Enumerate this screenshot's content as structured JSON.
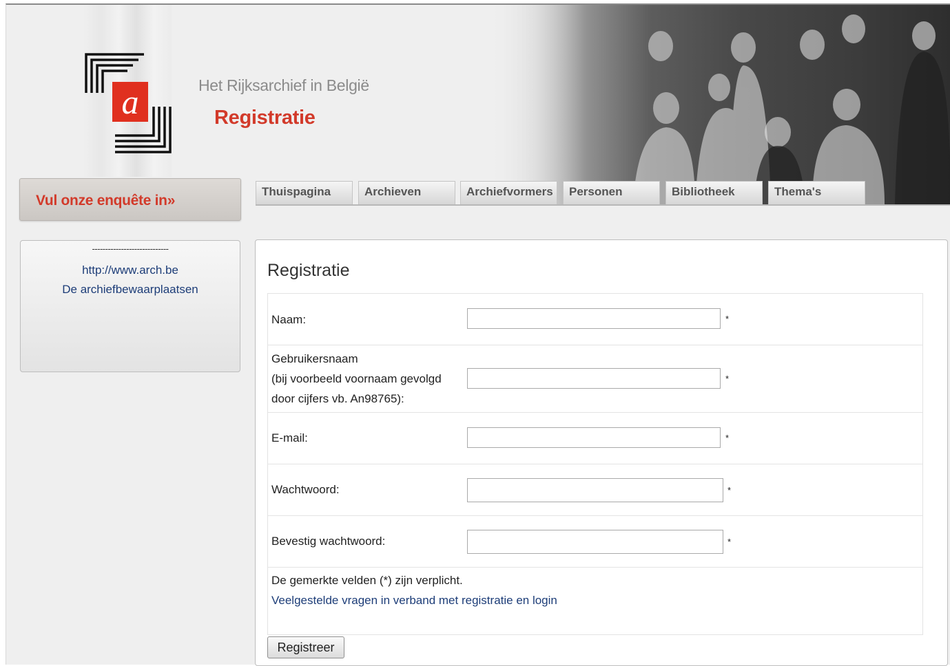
{
  "header": {
    "site_name": "Het Rijksarchief in België",
    "page_heading": "Registratie",
    "logo_letter": "a"
  },
  "survey": {
    "label": "Vul onze enquête in»"
  },
  "tabs": [
    {
      "label": "Thuispagina"
    },
    {
      "label": "Archieven"
    },
    {
      "label": "Archiefvormers"
    },
    {
      "label": "Personen"
    },
    {
      "label": "Bibliotheek"
    },
    {
      "label": "Thema's"
    }
  ],
  "sidebar": {
    "separator": "-----------------------------",
    "links": [
      {
        "label": "http://www.arch.be"
      },
      {
        "label": "De archiefbewaarplaatsen"
      }
    ]
  },
  "form": {
    "title": "Registratie",
    "fields": [
      {
        "label": "Naam:",
        "value": "",
        "required_mark": "*"
      },
      {
        "label_lines": [
          "Gebruikersnaam",
          "(bij voorbeeld voornaam gevolgd",
          "door cijfers vb. An98765):"
        ],
        "value": "",
        "required_mark": "*"
      },
      {
        "label": "E-mail:",
        "value": "",
        "required_mark": "*"
      },
      {
        "label": "Wachtwoord:",
        "value": "",
        "required_mark": "*"
      },
      {
        "label": "Bevestig wachtwoord:",
        "value": "",
        "required_mark": "*"
      }
    ],
    "required_note": "De gemerkte velden (*) zijn verplicht.",
    "faq_link": "Veelgestelde vragen in verband met registratie en login",
    "submit_label": "Registreer"
  },
  "colors": {
    "accent_red": "#d23a2a",
    "link_blue": "#1d3d78",
    "page_bg": "#efefef"
  }
}
